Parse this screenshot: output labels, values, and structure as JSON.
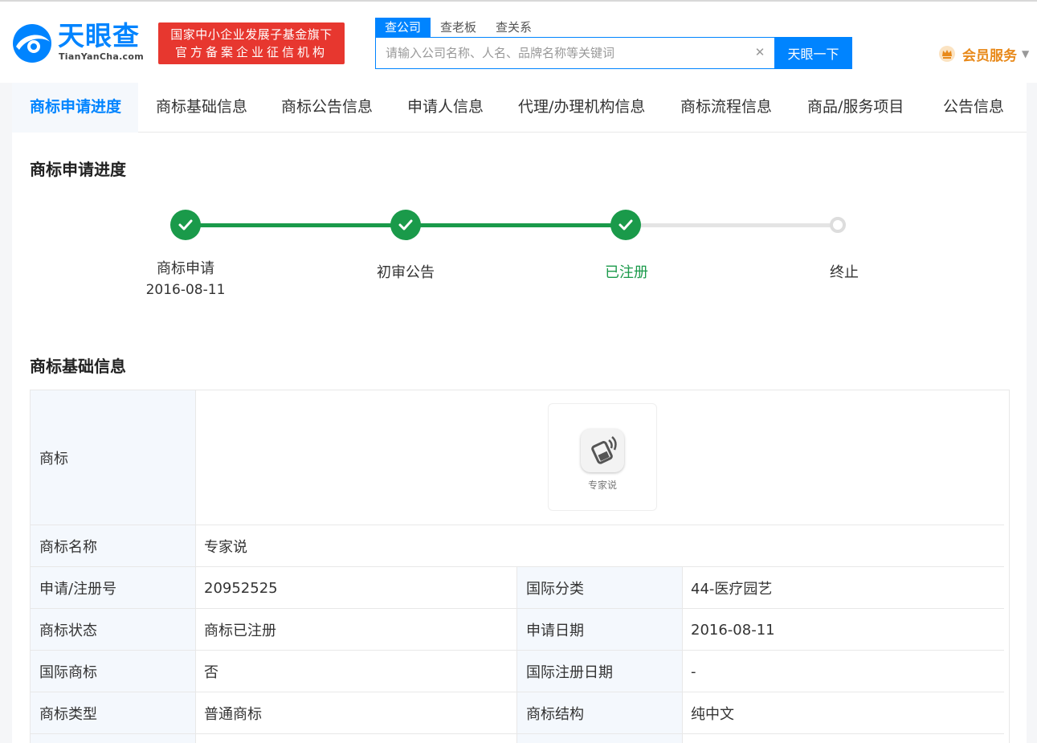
{
  "header": {
    "logo_text": "天眼查",
    "logo_sub": "TianYanCha.com",
    "badge_line1": "国家中小企业发展子基金旗下",
    "badge_line2": "官方备案企业征信机构",
    "search_tabs": [
      "查公司",
      "查老板",
      "查关系"
    ],
    "search_placeholder": "请输入公司名称、人名、品牌名称等关键词",
    "search_button": "天眼一下",
    "vip_label": "会员服务"
  },
  "nav": {
    "items": [
      "商标申请进度",
      "商标基础信息",
      "商标公告信息",
      "申请人信息",
      "代理/办理机构信息",
      "商标流程信息",
      "商品/服务项目",
      "公告信息"
    ]
  },
  "progress": {
    "title": "商标申请进度",
    "steps": [
      {
        "label": "商标申请",
        "date": "2016-08-11",
        "done": true
      },
      {
        "label": "初审公告",
        "date": "",
        "done": true
      },
      {
        "label": "已注册",
        "date": "",
        "done": true
      },
      {
        "label": "终止",
        "date": "",
        "done": false
      }
    ]
  },
  "basic_info": {
    "title": "商标基础信息",
    "trademark_label": "商标",
    "trademark_image_caption": "专家说",
    "name_label": "商标名称",
    "name_value": "专家说",
    "rows": [
      {
        "l1": "申请/注册号",
        "v1": "20952525",
        "l2": "国际分类",
        "v2": "44-医疗园艺"
      },
      {
        "l1": "商标状态",
        "v1": "商标已注册",
        "l2": "申请日期",
        "v2": "2016-08-11"
      },
      {
        "l1": "国际商标",
        "v1": "否",
        "l2": "国际注册日期",
        "v2": "-"
      },
      {
        "l1": "商标类型",
        "v1": "普通商标",
        "l2": "商标结构",
        "v2": "纯中文"
      }
    ]
  },
  "colors": {
    "brand_blue": "#0084ff",
    "badge_red": "#e7372f",
    "step_green": "#1a9a4a",
    "vip_orange": "#e8891a"
  }
}
